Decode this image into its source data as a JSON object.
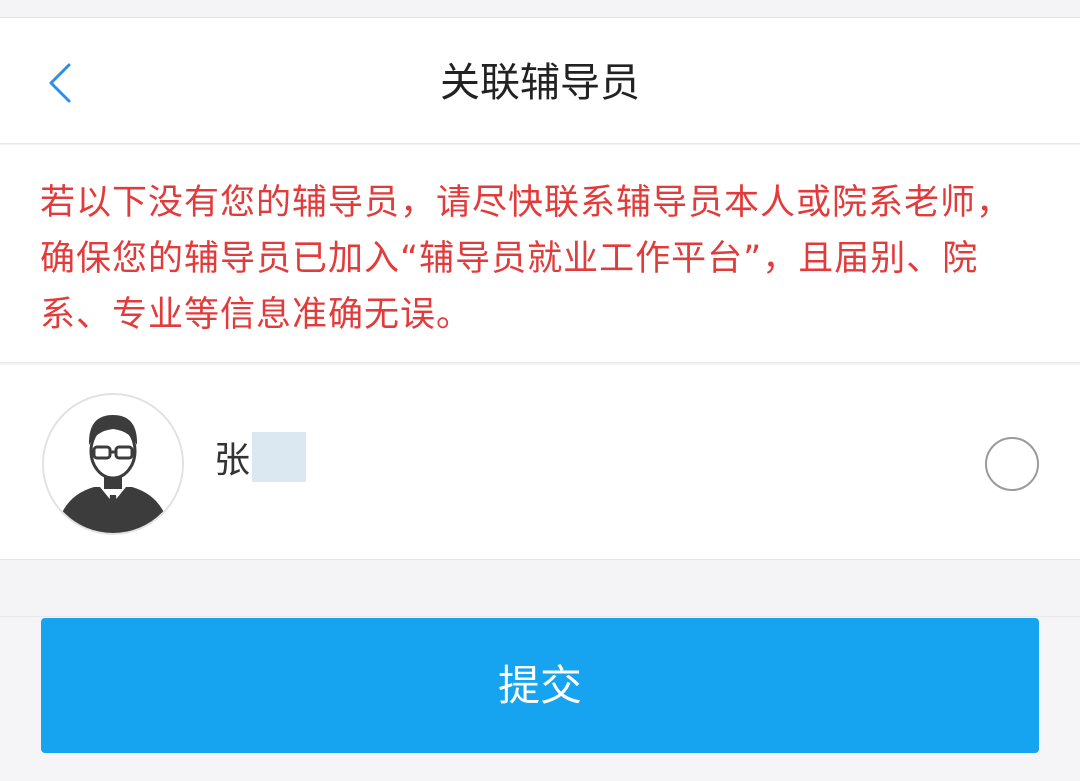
{
  "header": {
    "title": "关联辅导员",
    "back_icon": "chevron-left-icon"
  },
  "notice": {
    "text": "若以下没有您的辅导员，请尽快联系辅导员本人或院系老师，确保您的辅导员已加入“辅导员就业工作平台”，且届别、院系、专业等信息准确无误。"
  },
  "counselors": [
    {
      "name": "张",
      "avatar_icon": "user-avatar-icon",
      "selected": false
    }
  ],
  "actions": {
    "submit_label": "提交"
  },
  "colors": {
    "accent": "#16a3f0",
    "notice_text": "#e23b3b",
    "back_arrow": "#2f8de4",
    "page_bg": "#f4f4f6"
  }
}
